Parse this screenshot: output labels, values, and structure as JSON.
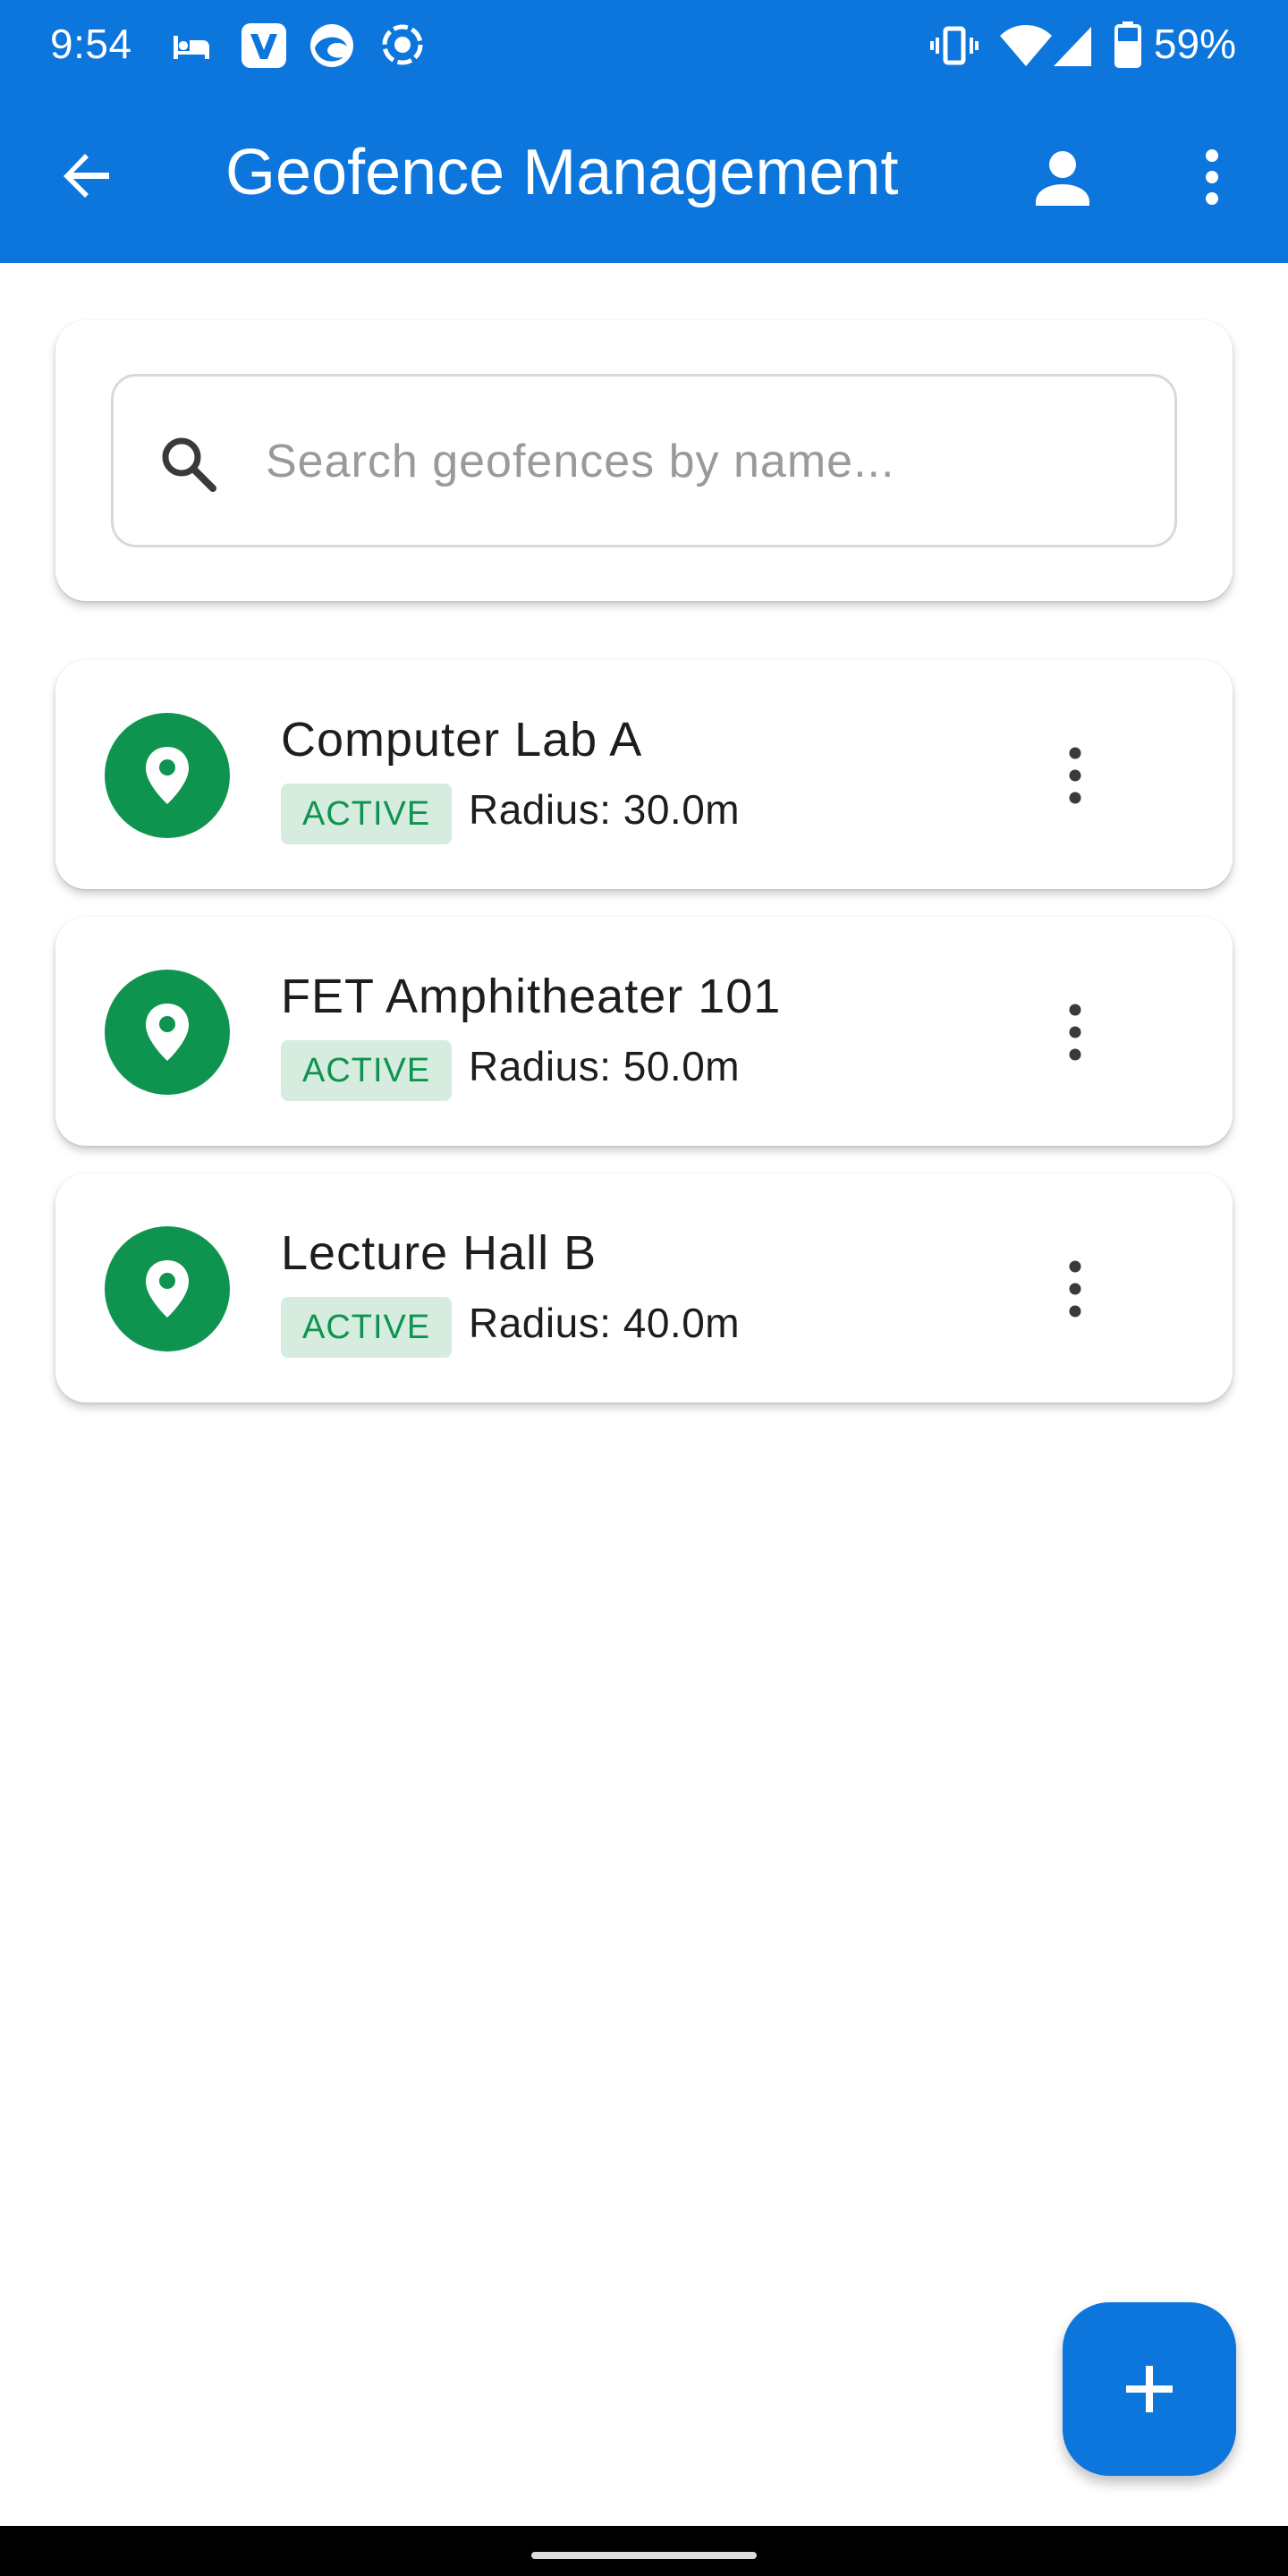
{
  "status_bar": {
    "time": "9:54",
    "battery_percent": "59%",
    "icons": [
      "bed-icon",
      "v-app-icon",
      "edge-icon",
      "screen-record-icon",
      "vibrate-icon",
      "wifi-icon",
      "signal-icon",
      "battery-icon"
    ]
  },
  "app_bar": {
    "title": "Geofence Management",
    "back_icon": "arrow-left-icon",
    "profile_icon": "person-icon",
    "more_icon": "more-vert-icon",
    "color": "#0c76dd"
  },
  "search": {
    "placeholder": "Search geofences by name...",
    "value": "",
    "icon": "search-icon"
  },
  "geofences": [
    {
      "name": "Computer Lab A",
      "status": "ACTIVE",
      "radius": "Radius: 30.0m"
    },
    {
      "name": "FET Amphitheater 101",
      "status": "ACTIVE",
      "radius": "Radius: 50.0m"
    },
    {
      "name": "Lecture Hall B",
      "status": "ACTIVE",
      "radius": "Radius: 40.0m"
    }
  ],
  "colors": {
    "accent": "#0c76dd",
    "active_green": "#0f944f",
    "active_badge_bg": "#d5ecdf"
  },
  "fab": {
    "icon": "plus-icon"
  }
}
